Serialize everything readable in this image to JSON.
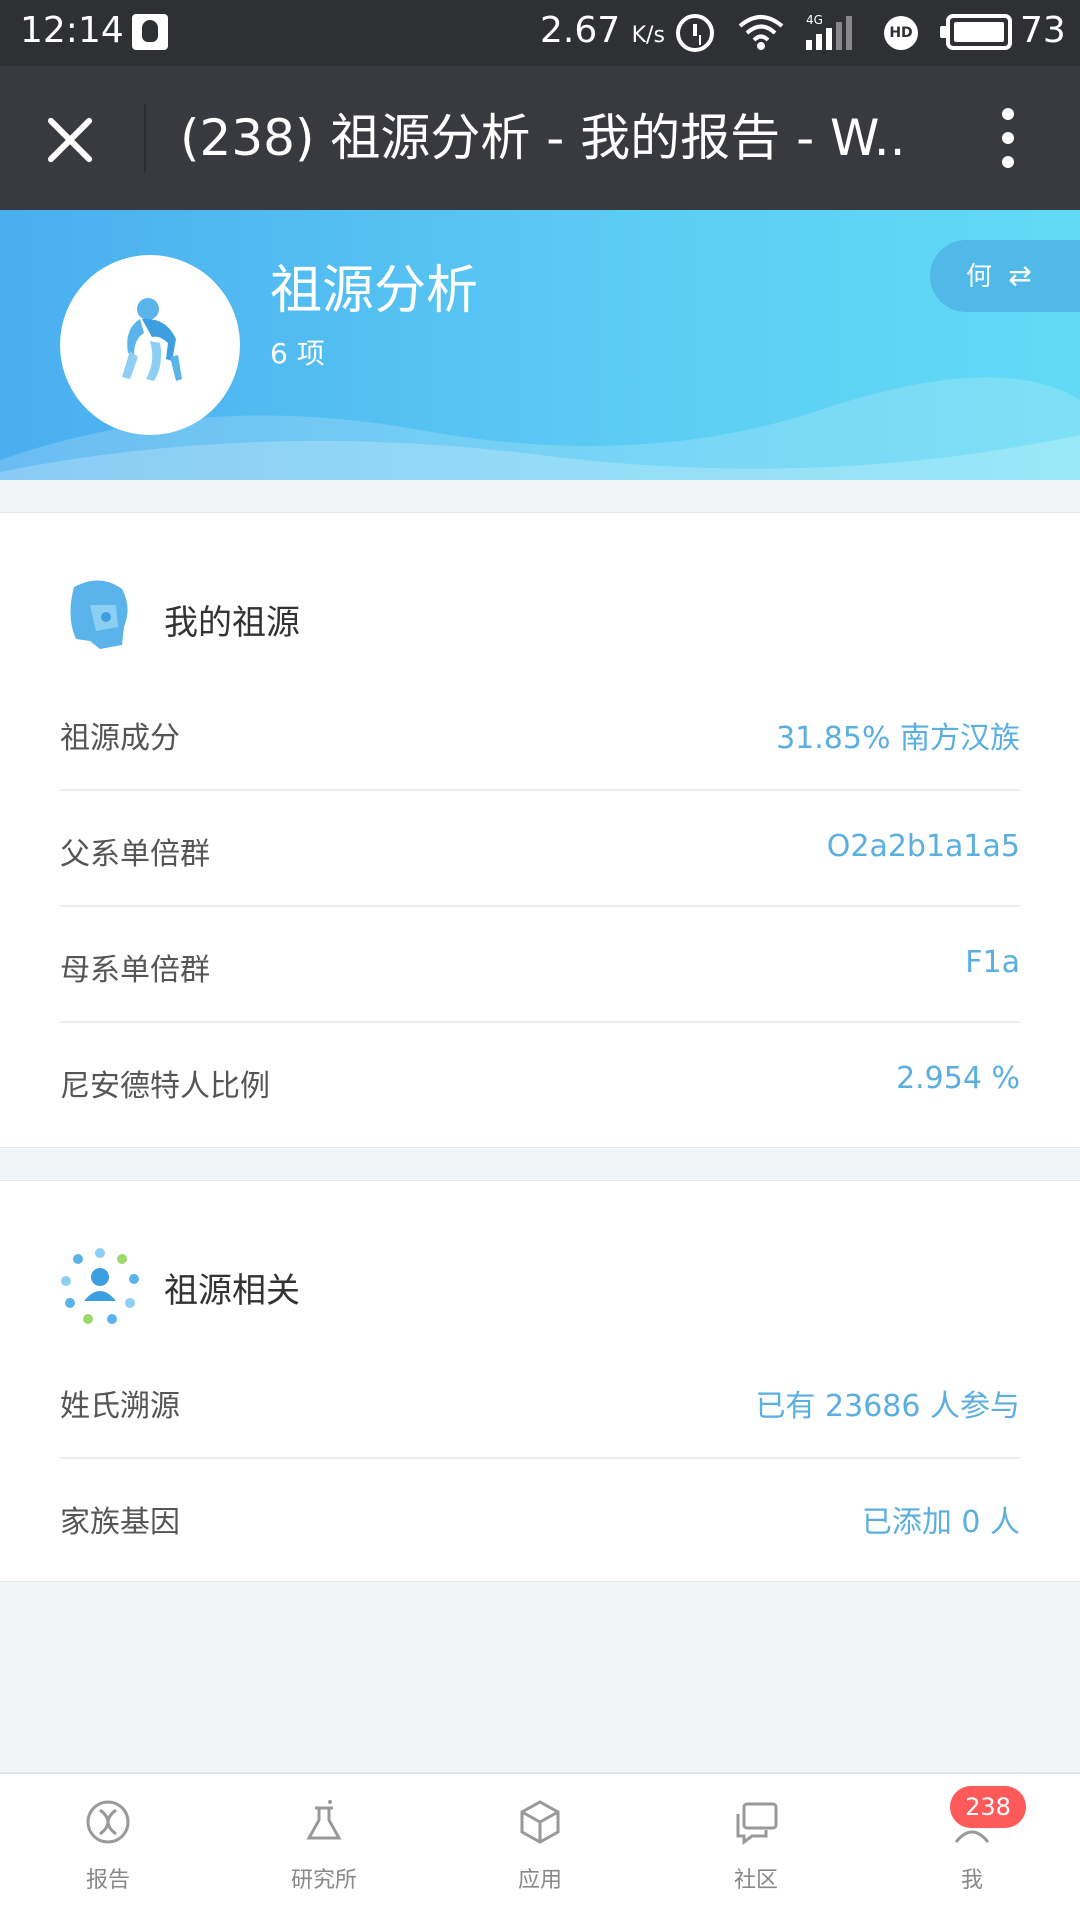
{
  "status_bar": {
    "time": "12:14",
    "speed": "2.67",
    "speed_unit": "K/s",
    "battery": "73"
  },
  "title_bar": {
    "title": "(238) 祖源分析 - 我的报告 - W.."
  },
  "header": {
    "title": "祖源分析",
    "count": "6 项",
    "switch_label": "何"
  },
  "my_ancestry": {
    "title": "我的祖源",
    "rows": [
      {
        "label": "祖源成分",
        "value": "31.85% 南方汉族"
      },
      {
        "label": "父系单倍群",
        "value": "O2a2b1a1a5"
      },
      {
        "label": "母系单倍群",
        "value": "F1a"
      },
      {
        "label": "尼安德特人比例",
        "value": "2.954 %"
      }
    ]
  },
  "ancestry_related": {
    "title": "祖源相关",
    "rows": [
      {
        "label": "姓氏溯源",
        "value": "已有 23686 人参与"
      },
      {
        "label": "家族基因",
        "value": "已添加 0 人"
      }
    ]
  },
  "bottom_nav": {
    "items": [
      {
        "label": "报告",
        "icon": "dna-icon"
      },
      {
        "label": "研究所",
        "icon": "flask-icon"
      },
      {
        "label": "应用",
        "icon": "cube-icon"
      },
      {
        "label": "社区",
        "icon": "chat-icon"
      },
      {
        "label": "我",
        "icon": "person-icon"
      }
    ],
    "badge": "238"
  },
  "colors": {
    "accent_blue": "#5aaee0",
    "header_gradient_start": "#4aaeef",
    "header_gradient_end": "#62daf5",
    "badge_red": "#ff5a5a",
    "titlebar": "#393a3f"
  }
}
